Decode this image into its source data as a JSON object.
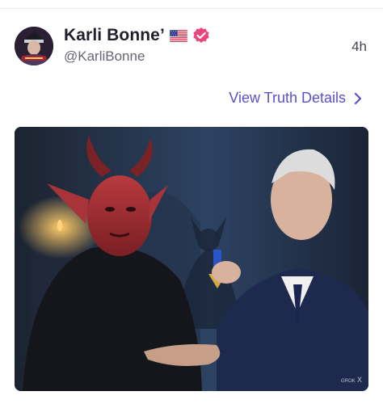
{
  "post": {
    "author": {
      "display_name": "Karli Bonne’",
      "handle": "@KarliBonne",
      "flag_icon": "us-flag-icon",
      "verified_icon": "verified-badge-icon",
      "verified_color": "#e8467c"
    },
    "timestamp": "4h",
    "view_details_label": "View Truth Details",
    "view_details_icon": "chevron-right-icon",
    "accent_color": "#5b4fcf",
    "image": {
      "watermark": "GROK"
    }
  }
}
